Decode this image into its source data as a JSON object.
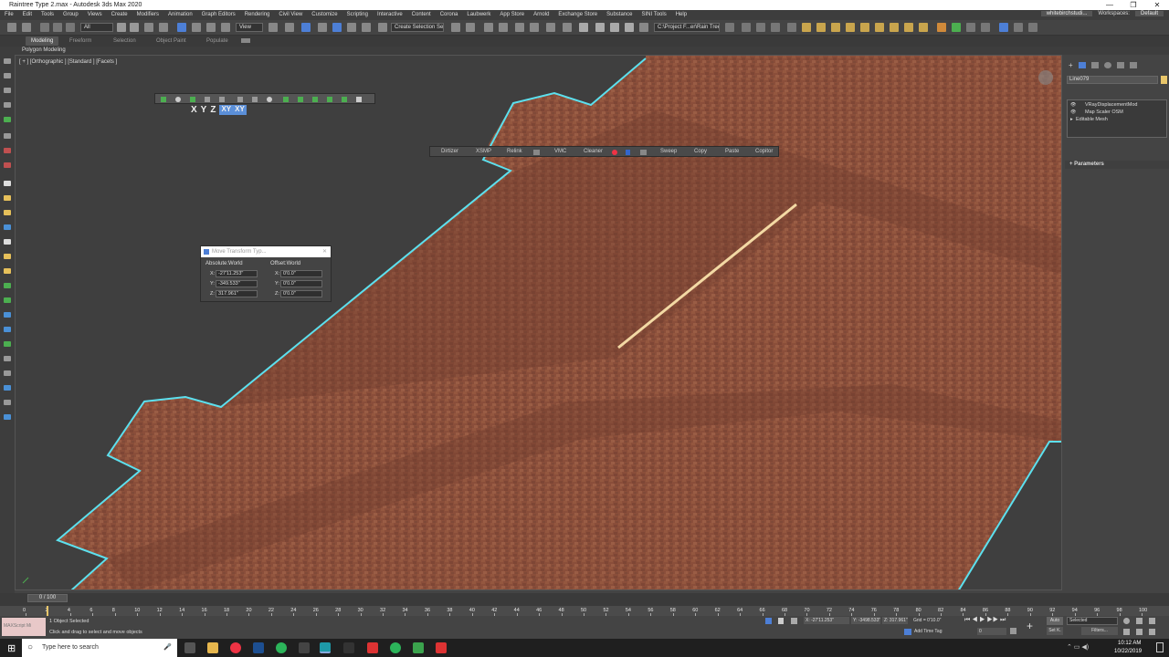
{
  "window": {
    "title": "Raintree Type 2.max - Autodesk 3ds Max 2020",
    "controls": [
      "—",
      "❐",
      "✕"
    ]
  },
  "menubar": {
    "items": [
      "File",
      "Edit",
      "Tools",
      "Group",
      "Views",
      "Create",
      "Modifiers",
      "Animation",
      "Graph Editors",
      "Rendering",
      "Civil View",
      "Customize",
      "Scripting",
      "Interactive",
      "Content",
      "Corona",
      "Laubwerk",
      "App Store",
      "Arnold",
      "Exchange Store",
      "Substance",
      "SINI Tools",
      "Help"
    ],
    "user": "whitebirchstudi...",
    "workspaces_label": "Workspaces:",
    "workspace_value": "Default"
  },
  "toolbar": {
    "filter_value": "All",
    "view_value": "View",
    "selection_set": "Create Selection Set",
    "path_value": "C:\\Project F...er\\Rain Tree"
  },
  "ribbon": {
    "tabs": [
      "Modeling",
      "Freeform",
      "Selection",
      "Object Paint",
      "Populate"
    ],
    "active_tab": "Modeling",
    "subtitle": "Polygon Modeling"
  },
  "viewport": {
    "label": "[ + ] [Orthographic ] [Standard ] [Facets ]"
  },
  "axis_toolbar": {
    "axes": [
      "X",
      "Y",
      "Z",
      "XY",
      "XY"
    ]
  },
  "quick_toolbar": {
    "items": [
      "Dirtizer",
      "XSMP",
      "Relink",
      "VMC",
      "Cleaner",
      "Sweep",
      "Copy",
      "Paste",
      "Copitor"
    ]
  },
  "transform_dialog": {
    "title": "Move Transform Typ...",
    "absolute_label": "Absolute:World",
    "offset_label": "Offset:World",
    "abs_x": "-27'11.253\"",
    "abs_y": "-349.533\"",
    "abs_z": "317.961\"",
    "off_x": "0'0.0\"",
    "off_y": "0'0.0\"",
    "off_z": "0'0.0\"",
    "axis_x": "X:",
    "axis_y": "Y:",
    "axis_z": "Z:"
  },
  "command_panel": {
    "object_name": "Line079",
    "modifiers": [
      "VRayDisplacementMod",
      "Map Scaler OSM",
      "Editable Mesh"
    ],
    "rollout": "Parameters",
    "accent_color": "#e8c66a"
  },
  "timeline": {
    "frame": "0 / 100",
    "ticks": [
      "0",
      "2",
      "4",
      "6",
      "8",
      "10",
      "12",
      "14",
      "16",
      "18",
      "20",
      "22",
      "24",
      "26",
      "28",
      "30",
      "32",
      "34",
      "36",
      "38",
      "40",
      "42",
      "44",
      "46",
      "48",
      "50",
      "52",
      "54",
      "56",
      "58",
      "60",
      "62",
      "64",
      "66",
      "68",
      "70",
      "72",
      "74",
      "76",
      "78",
      "80",
      "82",
      "84",
      "86",
      "88",
      "90",
      "92",
      "94",
      "96",
      "98",
      "100"
    ]
  },
  "status": {
    "maxscript": "MAXScript Mi",
    "selected": "1 Object Selected",
    "hint": "Click and drag to select and move objects",
    "x": "X: -27'11.253\"",
    "y": "Y: -3498.533\"",
    "z": "Z: 317.961\"",
    "grid": "Grid = 0'10.0\"",
    "add_time_tag": "Add Time Tag",
    "auto": "Auto",
    "set_key": "Set K.",
    "selected_dropdown": "Selected",
    "filters": "Filters...",
    "frame_value": "0"
  },
  "taskbar": {
    "search_placeholder": "Type here to search",
    "time": "10:12 AM",
    "date": "10/22/2019"
  },
  "colors": {
    "selection_outline": "#5ce0ee",
    "line_highlight": "#f3d9a4",
    "terrain": "#8a4e3a"
  }
}
